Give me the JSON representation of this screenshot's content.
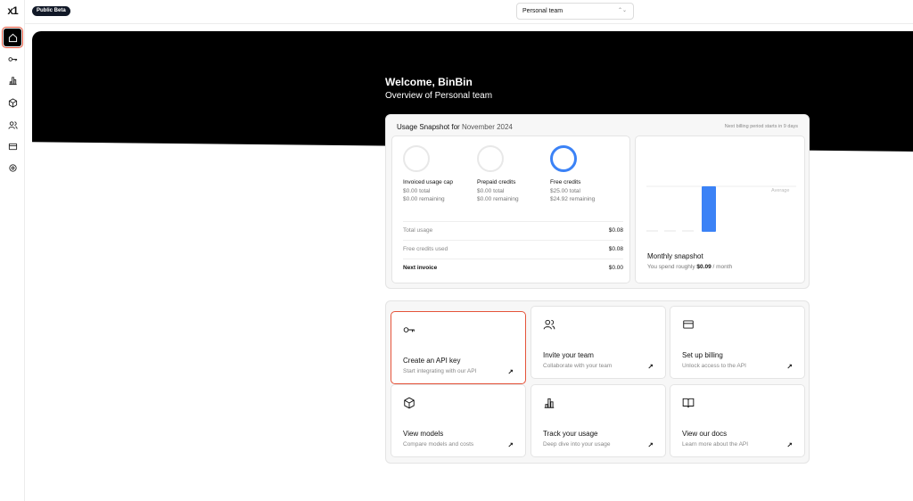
{
  "sidebar": {
    "logo": "x1",
    "items": [
      {
        "name": "home-icon",
        "active": true
      },
      {
        "name": "key-icon"
      },
      {
        "name": "bar-chart-icon"
      },
      {
        "name": "cube-icon"
      },
      {
        "name": "users-icon"
      },
      {
        "name": "card-icon"
      },
      {
        "name": "gear-icon"
      }
    ]
  },
  "topbar": {
    "badge": "Public Beta",
    "team_select": "Personal team"
  },
  "hero": {
    "welcome": "Welcome, BinBin",
    "overview": "Overview of Personal team"
  },
  "usage": {
    "title_prefix": "Usage Snapshot for",
    "month": "November 2024",
    "billing_note": "Next billing period starts in 9 days",
    "credits": [
      {
        "name": "Invoiced usage cap",
        "total": "$0.00 total",
        "remaining": "$0.00 remaining",
        "ring": "gray"
      },
      {
        "name": "Prepaid credits",
        "total": "$0.00 total",
        "remaining": "$0.00 remaining",
        "ring": "gray"
      },
      {
        "name": "Free credits",
        "total": "$25.00 total",
        "remaining": "$24.92 remaining",
        "ring": "blue"
      }
    ],
    "rows": [
      {
        "label": "Total usage",
        "value": "$0.08"
      },
      {
        "label": "Free credits used",
        "value": "$0.08"
      },
      {
        "label": "Next invoice",
        "value": "$0.00"
      }
    ]
  },
  "snapshot": {
    "average_label": "Average",
    "title": "Monthly snapshot",
    "sub_prefix": "You spend roughly",
    "amount": "$0.09",
    "sub_suffix": "/ month",
    "bar_color": "#3b82f6"
  },
  "actions": [
    {
      "title": "Create an API key",
      "sub": "Start integrating with our API",
      "icon": "key-icon",
      "highlight": true
    },
    {
      "title": "Invite your team",
      "sub": "Collaborate with your team",
      "icon": "users-icon"
    },
    {
      "title": "Set up billing",
      "sub": "Unlock access to the API",
      "icon": "card-icon"
    },
    {
      "title": "View models",
      "sub": "Compare models and costs",
      "icon": "cube-icon"
    },
    {
      "title": "Track your usage",
      "sub": "Deep dive into your usage",
      "icon": "bar-chart-icon"
    },
    {
      "title": "View our docs",
      "sub": "Learn more about the API",
      "icon": "book-icon"
    }
  ],
  "colors": {
    "accent": "#3b82f6",
    "highlight_border": "#e5533a",
    "banner": "#000000"
  }
}
